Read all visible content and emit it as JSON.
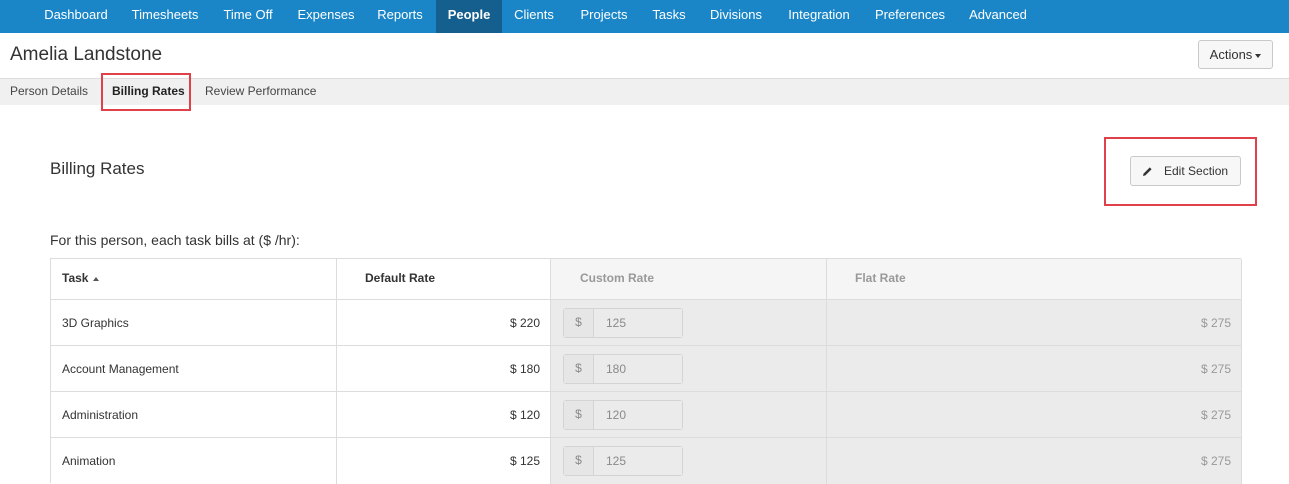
{
  "nav": {
    "items": [
      {
        "label": "Dashboard"
      },
      {
        "label": "Timesheets"
      },
      {
        "label": "Time Off"
      },
      {
        "label": "Expenses"
      },
      {
        "label": "Reports"
      },
      {
        "label": "People"
      },
      {
        "label": "Clients"
      },
      {
        "label": "Projects"
      },
      {
        "label": "Tasks"
      },
      {
        "label": "Divisions"
      },
      {
        "label": "Integration"
      },
      {
        "label": "Preferences"
      },
      {
        "label": "Advanced"
      }
    ],
    "active": "People"
  },
  "person": {
    "name": "Amelia Landstone"
  },
  "actions_button": {
    "label": "Actions"
  },
  "tabs": [
    {
      "label": "Person Details"
    },
    {
      "label": "Billing Rates"
    },
    {
      "label": "Review Performance"
    }
  ],
  "section": {
    "title": "Billing Rates",
    "edit_label": "Edit Section",
    "intro": "For this person, each task bills at ($ /hr):"
  },
  "table": {
    "headers": {
      "task": "Task",
      "default": "Default Rate",
      "custom": "Custom Rate",
      "flat": "Flat Rate"
    },
    "currency": "$",
    "rows": [
      {
        "task": "3D Graphics",
        "default": "$ 220",
        "custom": "125",
        "flat": "$ 275"
      },
      {
        "task": "Account Management",
        "default": "$ 180",
        "custom": "180",
        "flat": "$ 275"
      },
      {
        "task": "Administration",
        "default": "$ 120",
        "custom": "120",
        "flat": "$ 275"
      },
      {
        "task": "Animation",
        "default": "$ 125",
        "custom": "125",
        "flat": "$ 275"
      }
    ]
  },
  "colors": {
    "nav_bg": "#1a86c8",
    "nav_active": "#155f8f",
    "highlight": "#e0404a"
  }
}
